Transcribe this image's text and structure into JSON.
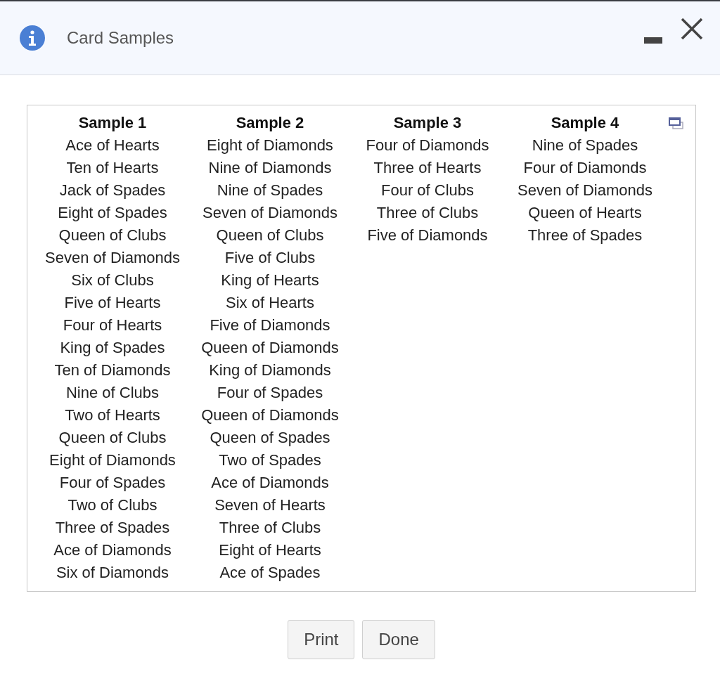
{
  "dialog": {
    "title": "Card Samples"
  },
  "samples": [
    {
      "title": "Sample 1",
      "cards": [
        "Ace of Hearts",
        "Ten of Hearts",
        "Jack of Spades",
        "Eight of Spades",
        "Queen of Clubs",
        "Seven of Diamonds",
        "Six of Clubs",
        "Five of Hearts",
        "Four of Hearts",
        "King of Spades",
        "Ten of Diamonds",
        "Nine of Clubs",
        "Two of Hearts",
        "Queen of Clubs",
        "Eight of Diamonds",
        "Four of Spades",
        "Two of Clubs",
        "Three of Spades",
        "Ace of Diamonds",
        "Six of Diamonds"
      ]
    },
    {
      "title": "Sample 2",
      "cards": [
        "Eight of Diamonds",
        "Nine of Diamonds",
        "Nine of Spades",
        "Seven of Diamonds",
        "Queen of Clubs",
        "Five of Clubs",
        "King of Hearts",
        "Six of Hearts",
        "Five of Diamonds",
        "Queen of Diamonds",
        "King of Diamonds",
        "Four of Spades",
        "Queen of Diamonds",
        "Queen of Spades",
        "Two of Spades",
        "Ace of Diamonds",
        "Seven of Hearts",
        "Three of Clubs",
        "Eight of Hearts",
        "Ace of Spades"
      ]
    },
    {
      "title": "Sample 3",
      "cards": [
        "Four of Diamonds",
        "Three of Hearts",
        "Four of Clubs",
        "Three of Clubs",
        "Five of Diamonds"
      ]
    },
    {
      "title": "Sample 4",
      "cards": [
        "Nine of Spades",
        "Four of Diamonds",
        "Seven of Diamonds",
        "Queen of Hearts",
        "Three of Spades"
      ]
    }
  ],
  "buttons": [
    "Print",
    "Done"
  ]
}
